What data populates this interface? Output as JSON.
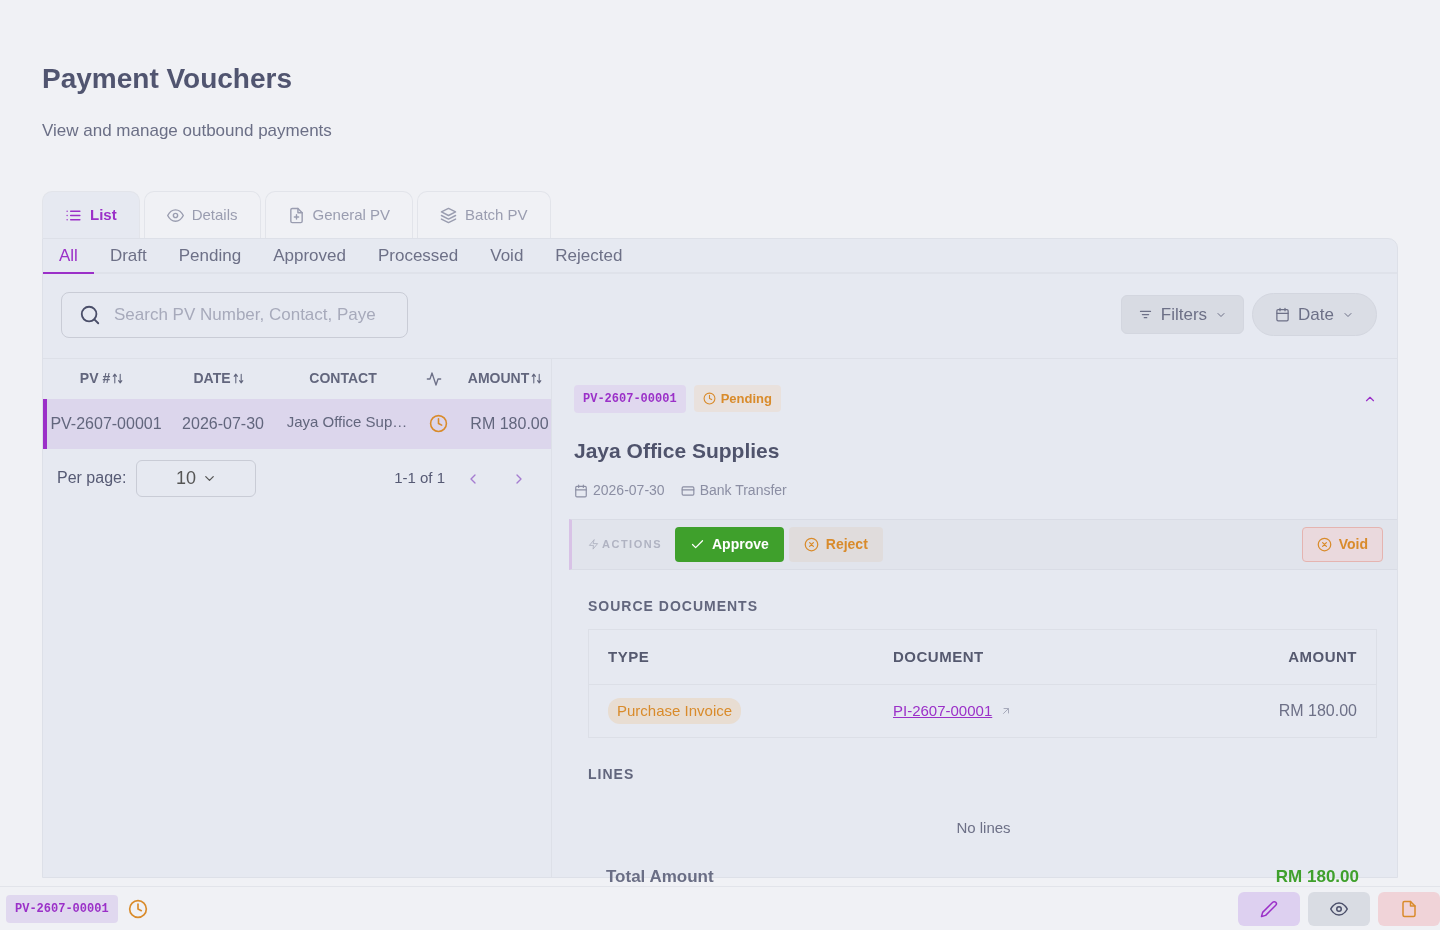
{
  "page": {
    "title": "Payment Vouchers",
    "subtitle": "View and manage outbound payments"
  },
  "view_tabs": [
    {
      "label": "List",
      "selected": true
    },
    {
      "label": "Details",
      "selected": false
    },
    {
      "label": "General PV",
      "selected": false
    },
    {
      "label": "Batch PV",
      "selected": false
    }
  ],
  "status_tabs": [
    {
      "label": "All",
      "selected": true
    },
    {
      "label": "Draft",
      "selected": false
    },
    {
      "label": "Pending",
      "selected": false
    },
    {
      "label": "Approved",
      "selected": false
    },
    {
      "label": "Processed",
      "selected": false
    },
    {
      "label": "Void",
      "selected": false
    },
    {
      "label": "Rejected",
      "selected": false
    }
  ],
  "search": {
    "placeholder": "Search PV Number, Contact, Paye"
  },
  "filters_button": "Filters",
  "date_button": "Date",
  "table": {
    "columns": [
      {
        "kind": "text",
        "label": "PV #",
        "sortable": true
      },
      {
        "kind": "text",
        "label": "DATE",
        "sortable": true
      },
      {
        "kind": "text",
        "label": "CONTACT",
        "sortable": false
      },
      {
        "kind": "icon",
        "sortable": false
      },
      {
        "kind": "text",
        "label": "AMOUNT",
        "sortable": true
      }
    ],
    "rows": [
      {
        "pv": "PV-2607-00001",
        "date": "2026-07-30",
        "contact": "Jaya Office Sup…",
        "pending": true,
        "amount": "RM 180.00",
        "selected": true
      }
    ]
  },
  "pagination": {
    "per_page_label": "Per page:",
    "per_page": "10",
    "range": "1-1 of 1"
  },
  "detail": {
    "number": "PV-2607-00001",
    "pending": true,
    "status_label": "Pending",
    "expanded": true,
    "contact": "Jaya Office Supplies",
    "date": "2026-07-30",
    "method": "Bank Transfer",
    "actions_label": "ACTIONS",
    "actions": [
      {
        "kind": "approve",
        "label": "Approve"
      },
      {
        "kind": "reject",
        "label": "Reject"
      },
      {
        "kind": "void",
        "label": "Void"
      }
    ],
    "source_title": "SOURCE DOCUMENTS",
    "source_columns": [
      "TYPE",
      "DOCUMENT",
      "AMOUNT"
    ],
    "source_rows": [
      {
        "type": "Purchase Invoice",
        "document": "PI-2607-00001",
        "amount": "RM 180.00"
      }
    ],
    "lines_title": "LINES",
    "lines_empty": "No lines",
    "total_label": "Total Amount",
    "total_value": "RM 180.00"
  },
  "footer": {
    "number": "PV-2607-00001",
    "pending": true
  }
}
